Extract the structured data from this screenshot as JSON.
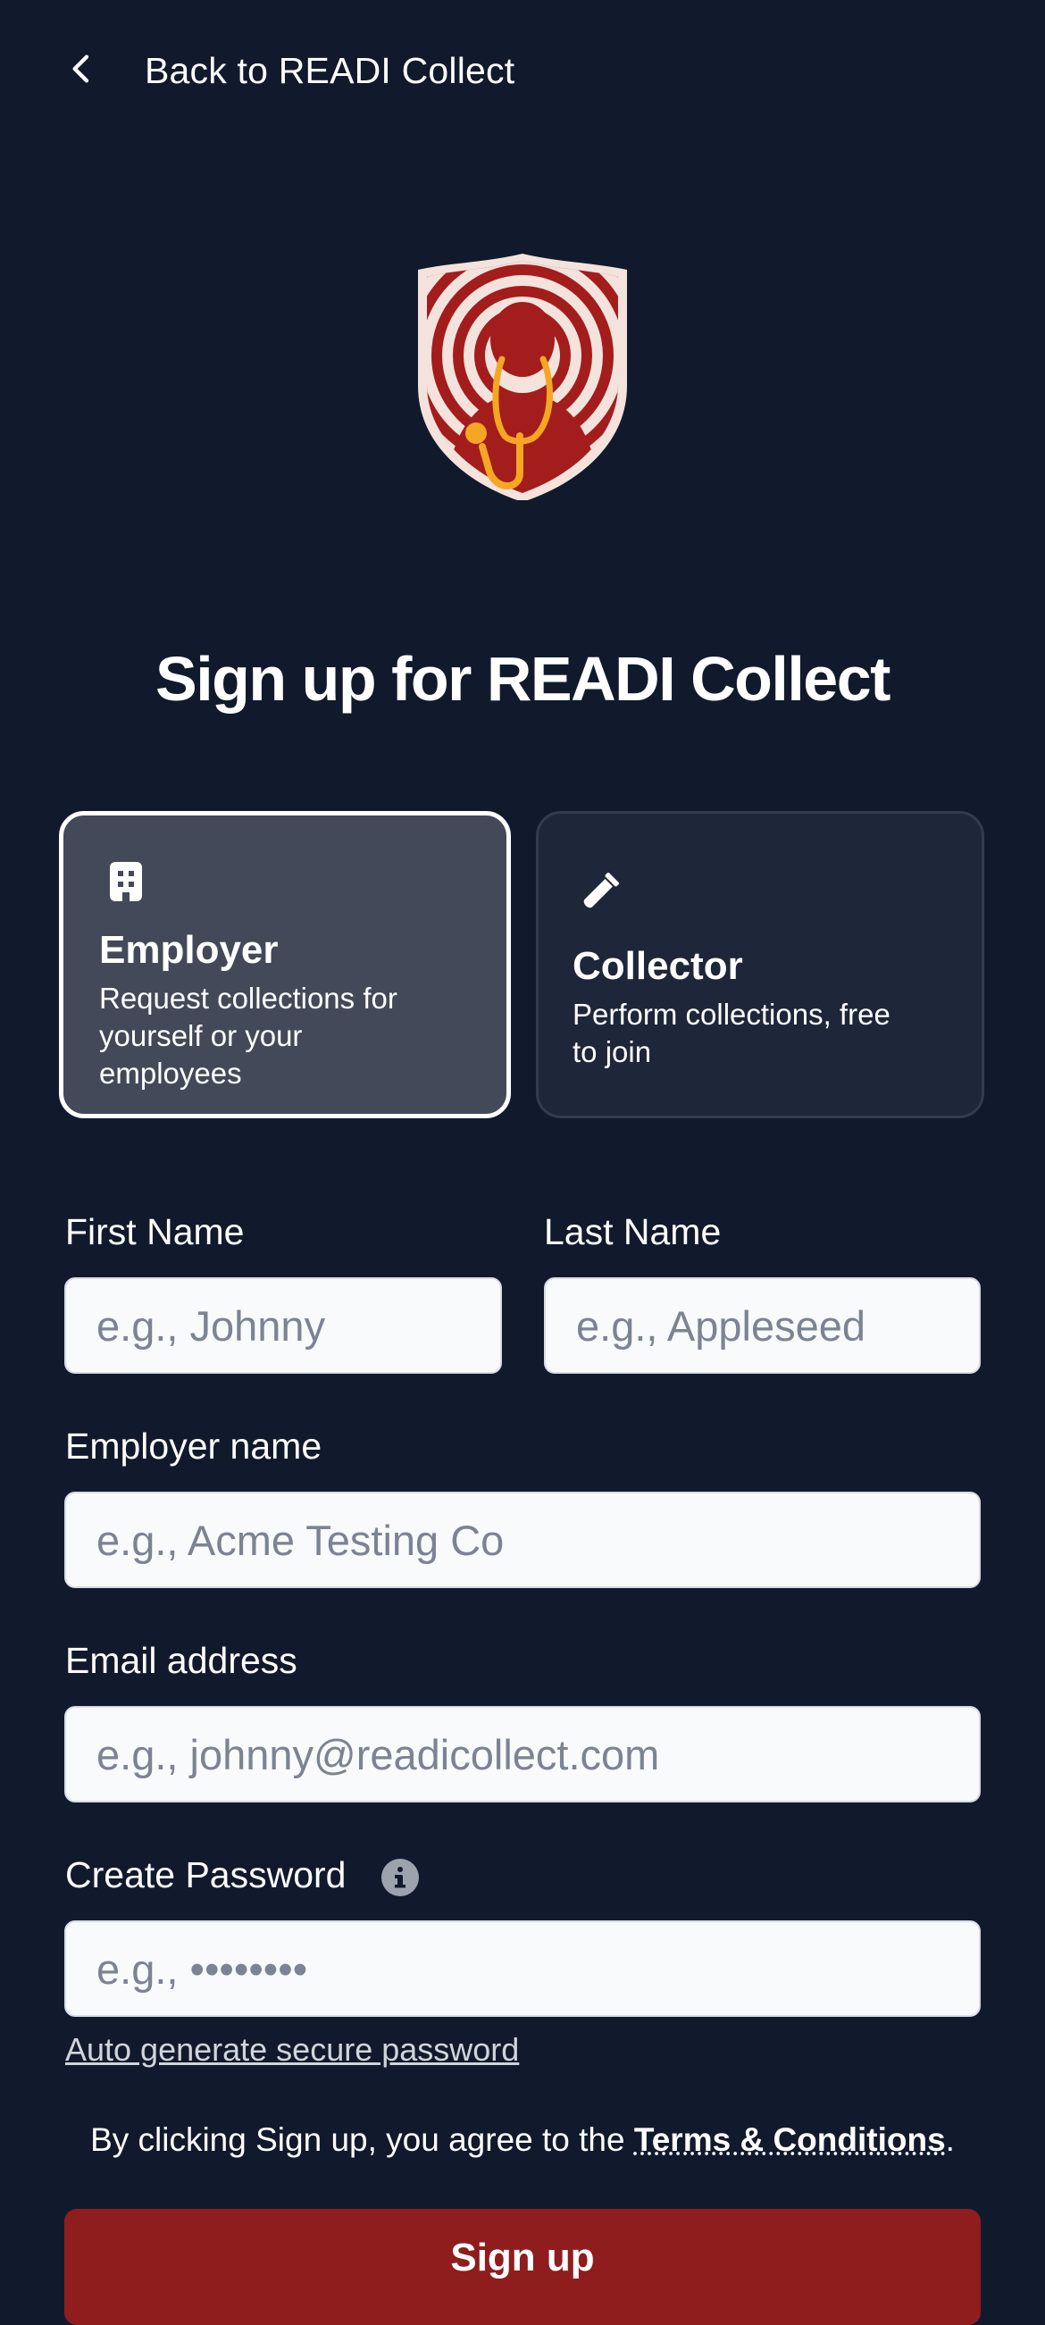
{
  "header": {
    "back_label": "Back to READI Collect"
  },
  "page": {
    "title": "Sign up for READI Collect"
  },
  "roles": {
    "employer": {
      "title": "Employer",
      "desc_line1": "Request collections for",
      "desc_line2": "yourself or your",
      "desc_line3": "employees"
    },
    "collector": {
      "title": "Collector",
      "desc_line1": "Perform collections, free",
      "desc_line2": "to join"
    }
  },
  "form": {
    "first_name": {
      "label": "First Name",
      "placeholder": "e.g., Johnny"
    },
    "last_name": {
      "label": "Last Name",
      "placeholder": "e.g., Appleseed"
    },
    "employer_name": {
      "label": "Employer name",
      "placeholder": "e.g., Acme Testing Co"
    },
    "email": {
      "label": "Email address",
      "placeholder": "e.g., johnny@readicollect.com"
    },
    "password": {
      "label": "Create Password",
      "placeholder": "e.g., ••••••••"
    },
    "autogen_label": "Auto generate secure password"
  },
  "terms": {
    "prefix": "By clicking Sign up, you agree to the ",
    "link": "Terms & Conditions",
    "suffix": "."
  },
  "submit": {
    "label": "Sign up"
  },
  "colors": {
    "background": "#111a2d",
    "brand_red": "#8f1d1d",
    "selected_card": "#434959",
    "card": "#1e2639"
  }
}
